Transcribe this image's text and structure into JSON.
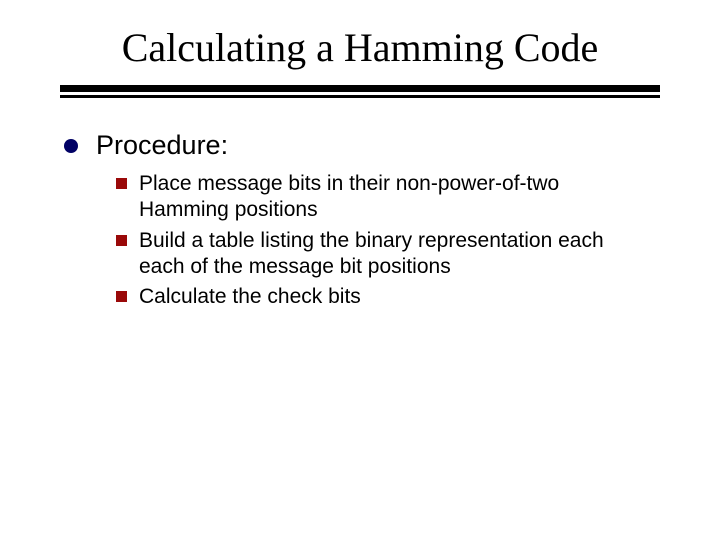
{
  "title": "Calculating a Hamming Code",
  "level1": {
    "label": "Procedure:"
  },
  "level2": {
    "items": [
      {
        "text": "Place message bits in their non-power-of-two Hamming positions"
      },
      {
        "text": "Build a table listing the binary representation each each of the message bit positions"
      },
      {
        "text": "Calculate the check bits"
      }
    ]
  },
  "colors": {
    "bulletL1": "#010165",
    "bulletL2": "#9a0909"
  }
}
